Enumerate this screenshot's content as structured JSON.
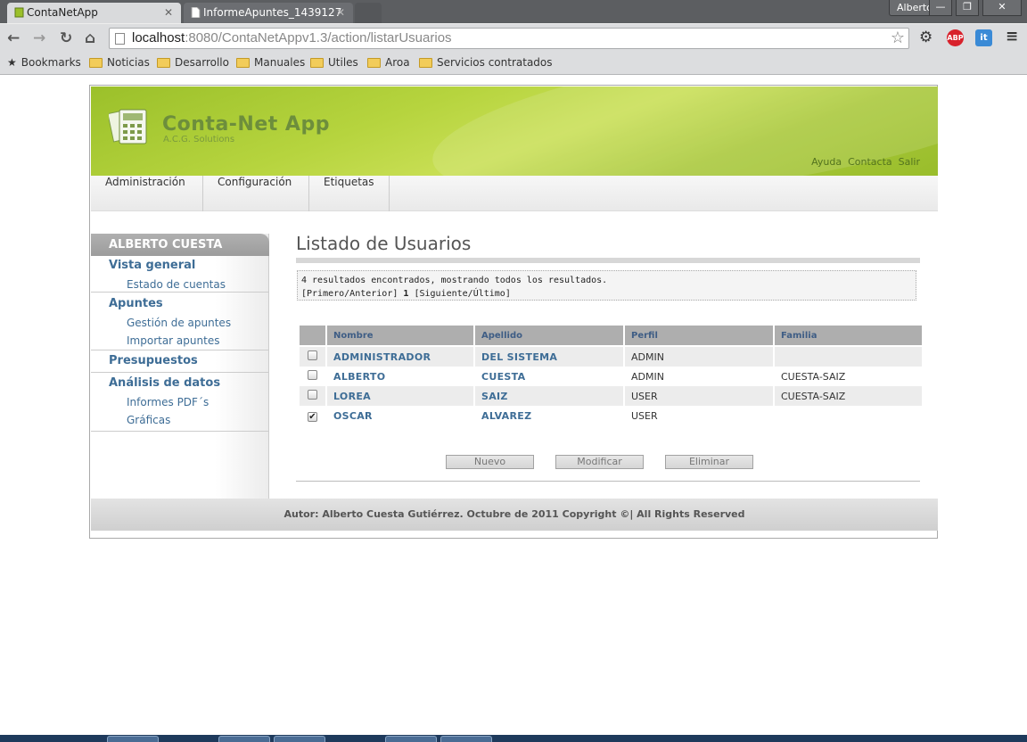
{
  "browser": {
    "tabs": [
      {
        "title": "ContaNetApp",
        "active": true
      },
      {
        "title": "InformeApuntes_1439127",
        "active": false
      }
    ],
    "user_button": "Alberto",
    "url_host": "localhost",
    "url_rest": ":8080/ContaNetAppv1.3/action/listarUsuarios",
    "bookmarks": [
      "Bookmarks",
      "Noticias",
      "Desarrollo",
      "Manuales",
      "Utiles",
      "Aroa",
      "Servicios contratados"
    ],
    "extensions": {
      "abp": "ABP",
      "it": "it"
    }
  },
  "header": {
    "app_title": "Conta-Net App",
    "app_subtitle": "A.C.G. Solutions",
    "links": [
      "Ayuda",
      "Contacta",
      "Salir"
    ]
  },
  "menu": [
    "Administración",
    "Configuración",
    "Etiquetas"
  ],
  "sidebar": {
    "user": "ALBERTO CUESTA",
    "groups": [
      {
        "label": "Vista general",
        "items": [
          "Estado de cuentas"
        ]
      },
      {
        "label": "Apuntes",
        "items": [
          "Gestión de apuntes",
          "Importar apuntes"
        ]
      },
      {
        "label": "Presupuestos",
        "items": []
      },
      {
        "label": "Análisis de datos",
        "items": [
          "Informes PDF´s",
          "Gráficas"
        ]
      }
    ]
  },
  "main": {
    "title": "Listado de Usuarios",
    "results_line": "4 resultados encontrados, mostrando todos los resultados.",
    "pager_prev": "[Primero/Anterior]",
    "pager_current": "1",
    "pager_next": "[Siguiente/Último]",
    "columns": [
      "Nombre",
      "Apellido",
      "Perfil",
      "Familia"
    ],
    "rows": [
      {
        "checked": false,
        "nombre": "ADMINISTRADOR",
        "apellido": "DEL SISTEMA",
        "perfil": "ADMIN",
        "familia": ""
      },
      {
        "checked": false,
        "nombre": "ALBERTO",
        "apellido": "CUESTA",
        "perfil": "ADMIN",
        "familia": "CUESTA-SAIZ"
      },
      {
        "checked": false,
        "nombre": "LOREA",
        "apellido": "SAIZ",
        "perfil": "USER",
        "familia": "CUESTA-SAIZ"
      },
      {
        "checked": true,
        "nombre": "OSCAR",
        "apellido": "ALVAREZ",
        "perfil": "USER",
        "familia": ""
      }
    ],
    "buttons": {
      "nuevo": "Nuevo",
      "modificar": "Modificar",
      "eliminar": "Eliminar"
    }
  },
  "footer": {
    "text": "Autor: Alberto Cuesta Gutiérrez. Octubre de 2011 Copyright ©| All Rights Reserved"
  },
  "colors": {
    "header_green": "#b6d43e",
    "link_blue": "#3e6d96",
    "table_header": "#aeaeae"
  }
}
